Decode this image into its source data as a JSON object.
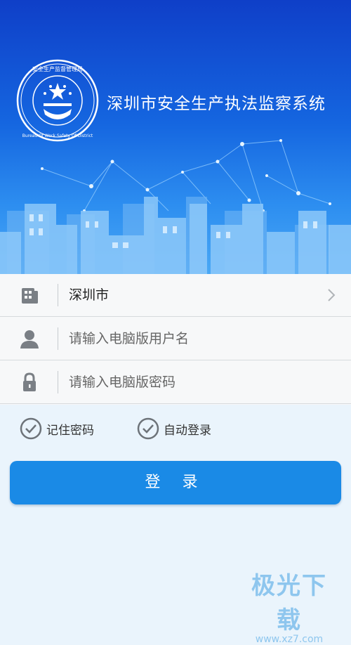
{
  "header": {
    "app_title": "深圳市安全生产执法监察系统",
    "emblem_text": "Bureau Of Work Safety Of District",
    "emblem_text_cn": "安全生产监督管理局"
  },
  "form": {
    "city": {
      "value": "深圳市",
      "icon": "building-icon"
    },
    "username": {
      "placeholder": "请输入电脑版用户名",
      "icon": "user-icon"
    },
    "password": {
      "placeholder": "请输入电脑版密码",
      "icon": "lock-icon"
    }
  },
  "options": {
    "remember_password": "记住密码",
    "auto_login": "自动登录"
  },
  "login_button": "登 录",
  "watermark": {
    "title": "极光下载",
    "url": "www.xz7.com"
  },
  "colors": {
    "primary": "#1a8ae6",
    "banner": "#1566e0",
    "watermark": "#8ec6ee"
  }
}
